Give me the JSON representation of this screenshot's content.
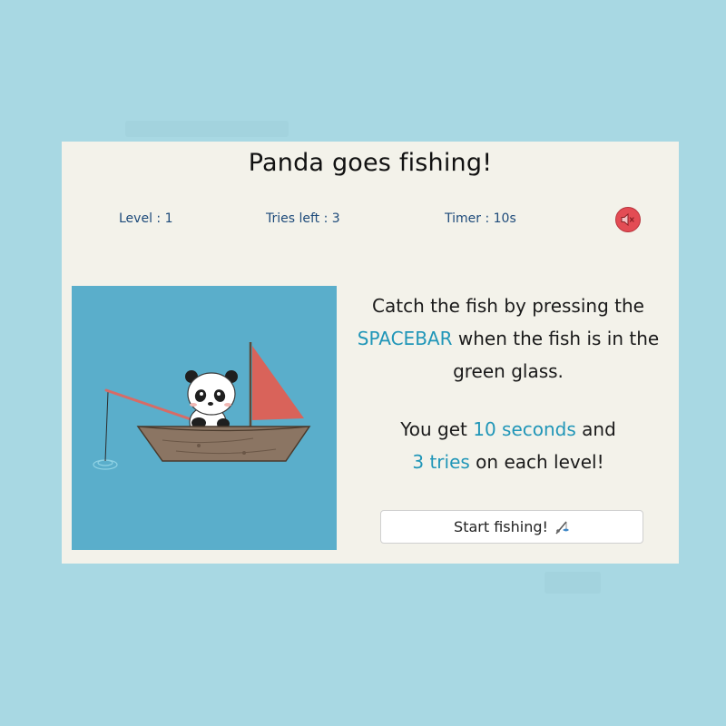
{
  "game": {
    "title": "Panda goes fishing!"
  },
  "stats": {
    "level": "Level : 1",
    "tries_left": "Tries left : 3",
    "timer": "Timer : 10s"
  },
  "sound": {
    "icon": "speaker-muted-icon",
    "color": "#e34c54"
  },
  "instructions": {
    "line1_pre": "Catch the fish by pressing the",
    "spacebar": "SPACEBAR",
    "line2_post": " when the fish is in the green glass.",
    "line3_pre": "You get ",
    "seconds": "10 seconds",
    "line3_post": " and",
    "tries": "3 tries",
    "line4_post": " on each level!",
    "highlight_color": "#2096b8"
  },
  "start_button": {
    "label": "Start fishing!",
    "icon": "fishing-pole-icon"
  },
  "colors": {
    "background": "#a8d8e3",
    "card": "#f3f2ea",
    "water": "#5aaecb",
    "sail": "#d9635a",
    "boat": "#8b7563"
  }
}
